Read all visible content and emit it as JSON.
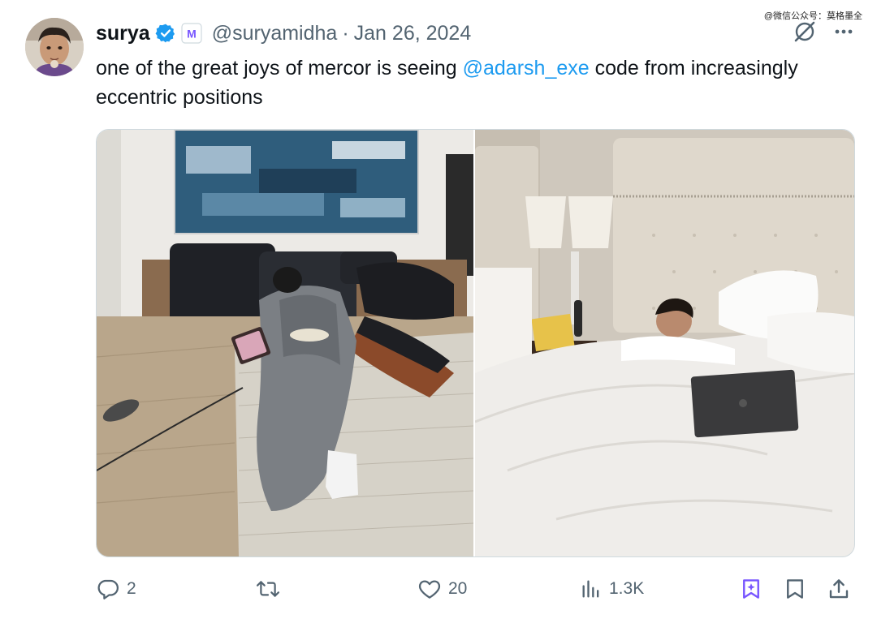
{
  "watermark": "@微信公众号：莫格墨全",
  "author": {
    "name": "surya",
    "handle": "@suryamidha",
    "separator": "·",
    "date": "Jan 26, 2024",
    "badge_letter": "M"
  },
  "tweet": {
    "text_before": "one of the great joys of mercor is seeing ",
    "mention": "@adarsh_exe",
    "text_after": " code from increasingly eccentric positions"
  },
  "stats": {
    "replies": "2",
    "retweets": "",
    "likes": "20",
    "views": "1.3K"
  },
  "icons": {
    "verified": "verified-badge-icon",
    "grok": "grok-icon",
    "more": "more-icon",
    "reply": "reply-icon",
    "retweet": "retweet-icon",
    "like": "heart-icon",
    "views": "views-icon",
    "grok_bookmark": "grok-bookmark-icon",
    "bookmark": "bookmark-icon",
    "share": "share-icon"
  },
  "colors": {
    "accent": "#1d9bf0",
    "text": "#0f1419",
    "muted": "#536471",
    "badge_purple": "#7856ff"
  }
}
